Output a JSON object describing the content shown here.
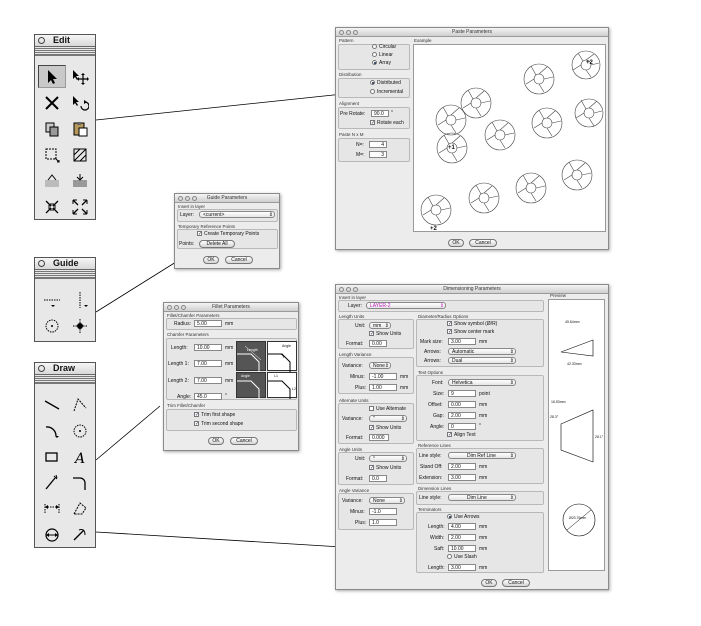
{
  "palettes": {
    "edit": {
      "title": "Edit",
      "tools": [
        "pointer-tool",
        "move-tool",
        "delete-tool",
        "rotate-tool",
        "copy-tool",
        "paste-tool",
        "crop-tool",
        "pattern-tool",
        "fill-tool",
        "hatch-tool",
        "shrink-tool",
        "expand-tool"
      ]
    },
    "guide": {
      "title": "Guide",
      "tools": [
        "horizontal-guide-tool",
        "vertical-guide-tool",
        "circle-guide-tool",
        "point-guide-tool"
      ]
    },
    "draw": {
      "title": "Draw",
      "tools": [
        "line-tool",
        "polyline-tool",
        "arc-tool",
        "circle-tool",
        "rectangle-tool",
        "text-tool",
        "freehand-tool",
        "fillet-tool",
        "dimension-tool",
        "polygon-tool",
        "angle-dimension-tool",
        "curve-tool"
      ]
    }
  },
  "paste": {
    "title": "Paste Parameters",
    "pattern_label": "Pattern",
    "pattern_options": [
      "Circular",
      "Linear",
      "Array"
    ],
    "distribution_label": "Distribution",
    "distribution_options": [
      "Distributed",
      "Incremental"
    ],
    "alignment_label": "Alignment",
    "prerotate_label": "Pre Rotate:",
    "prerotate_value": "90.0",
    "degree": "°",
    "rotate_each": "Rotate each",
    "paste_nm_label": "Paste N x M",
    "n_label": "N=:",
    "n_value": "4",
    "m_label": "M=:",
    "m_value": "3",
    "example_label": "Example",
    "first_tag": "+1",
    "second_tag": "+2",
    "ok": "OK",
    "cancel": "Cancel"
  },
  "guide_params": {
    "title": "Guide Parameters",
    "insert_label": "Insert in layer",
    "layer_label": "Layer:",
    "layer_value": "<current>",
    "temp_label": "Temporary Reference Points",
    "create_temp": "Create Temporary Points",
    "points_label": "Points:",
    "delete_all": "Delete All",
    "ok": "OK",
    "cancel": "Cancel"
  },
  "fillet": {
    "title": "Fillet Parameters",
    "fc_label": "Fillet/Chamfer Parameters",
    "radius_label": "Radius:",
    "radius_value": "5.00",
    "chamfer_label": "Chamfer Parameters",
    "length_label": "Length:",
    "length_value": "10.00",
    "length1_label": "Length 1:",
    "length1_value": "7.00",
    "length2_label": "Length 2:",
    "length2_value": "7.00",
    "angle_label": "Angle:",
    "angle_value": "45.0",
    "mm": "mm",
    "degree": "°",
    "diag_length": "Length",
    "diag_angle": "Angle",
    "diag_l1": "L1",
    "diag_l2": "L2",
    "trim_label": "Trim Fillet/Chamfer",
    "trim_first": "Trim first shape",
    "trim_second": "Trim second shape",
    "ok": "OK",
    "cancel": "Cancel"
  },
  "dim": {
    "title": "Dimensioning Parameters",
    "insert_label": "Insert in layer",
    "layer_label": "Layer:",
    "layer_value": "LAYER-2",
    "length_units": "Length Units",
    "unit_label": "Unit:",
    "unit_value": "mm",
    "show_units": "Show Units",
    "format_label": "Format:",
    "format_value": "0.00",
    "length_variance": "Length Variance",
    "variance_label": "Variance:",
    "variance_value": "None",
    "minus_label": "Minus:",
    "minus_value": "-1.00",
    "plus_label": "Plus:",
    "plus_value": "1.00",
    "alternate_units": "Alternate Units",
    "use_alternate": "Use Alternate",
    "alt_unit_value": "\"",
    "alt_format_value": "0.000",
    "angle_units": "Angle Units",
    "angle_unit_value": "°",
    "angle_format_value": "0.0",
    "angle_variance": "Angle Variance",
    "angle_minus_value": "-1.0",
    "angle_plus_value": "1.0",
    "diameter_label": "Diameter/Radius Options",
    "show_symbol": "Show symbol (Ø/R)",
    "show_center": "Show center mark",
    "mark_size_label": "Mark size:",
    "mark_size_value": "3.00",
    "arrows_label": "Arrows:",
    "arrows_value1": "Automatic",
    "arrows_value2": "Dual",
    "text_options": "Text Options",
    "font_label": "Font:",
    "font_value": "Helvetica",
    "size_label": "Size:",
    "size_value": "9",
    "point": "point",
    "offset_label": "Offset:",
    "offset_value": "0.00",
    "gap_label": "Gap:",
    "gap_value": "2.00",
    "angle_label": "Angle:",
    "angle_value": "0",
    "align_text": "Align Text",
    "ref_lines": "Reference Lines",
    "line_style_label": "Line style:",
    "ref_style_value": "Dim Ref Line",
    "stand_off_label": "Stand Off:",
    "stand_off_value": "2.00",
    "extension_label": "Extension:",
    "extension_value": "3.00",
    "dim_lines": "Dimension Lines",
    "dim_style_value": "Dim Line",
    "terminators": "Terminators",
    "use_arrows": "Use Arrows",
    "t_length_label": "Length:",
    "t_length_value": "4.00",
    "t_width_label": "Width:",
    "t_width_value": "2.00",
    "t_saft_label": "Saft:",
    "t_saft_value": "10.00",
    "use_slash": "Use Slash",
    "slash_length_value": "3.00",
    "mm": "mm",
    "preview_label": "Preview",
    "pv_top": "45.64mm",
    "pv_bottom": "42.33mm",
    "pv_angle": "28.3°",
    "pv_height": "16.53mm",
    "pv_right": "26.1°",
    "pv_circle": "Ø23.76mm",
    "ok": "OK",
    "cancel": "Cancel"
  }
}
